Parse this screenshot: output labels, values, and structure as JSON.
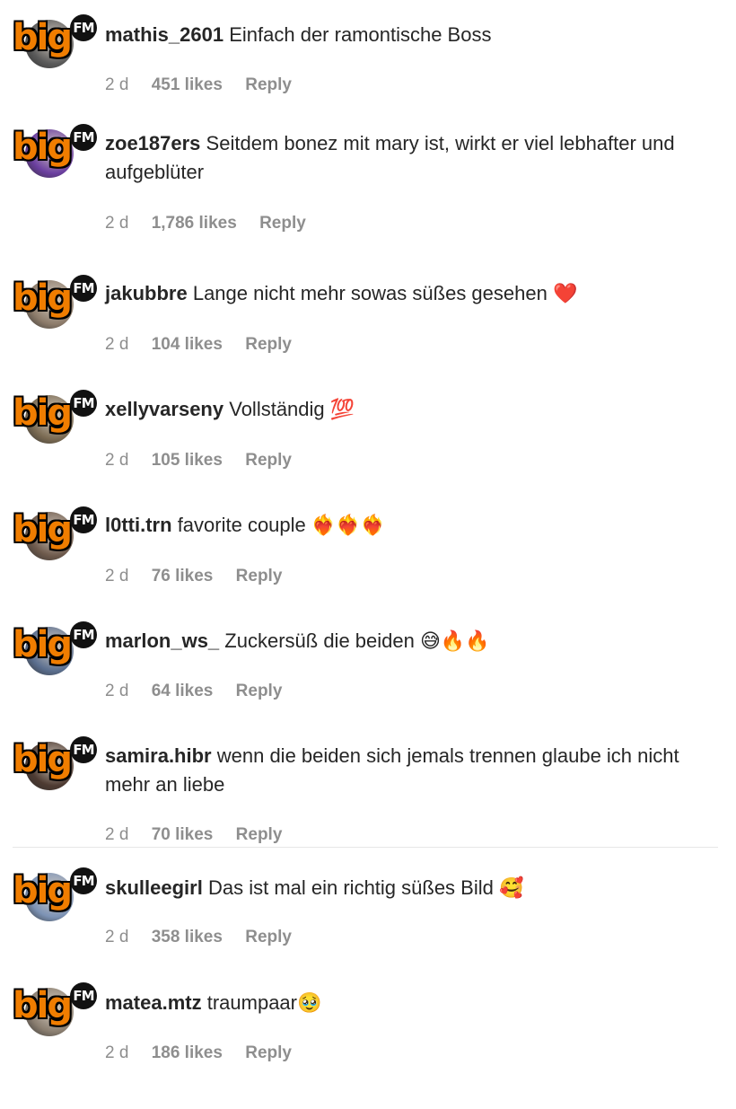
{
  "comments": [
    {
      "username": "mathis_2601",
      "text": "Einfach der ramontische Boss",
      "time": "2 d",
      "likes": "451 likes",
      "reply": "Reply",
      "avatar_bg": "#5a5a5a"
    },
    {
      "username": "zoe187ers",
      "text": "Seitdem bonez mit mary ist, wirkt er viel lebhafter und aufgeblüter",
      "time": "2 d",
      "likes": "1,786 likes",
      "reply": "Reply",
      "avatar_bg": "#6b3fa0"
    },
    {
      "username": "jakubbre",
      "text": "Lange nicht mehr sowas süßes gesehen ❤️",
      "time": "2 d",
      "likes": "104 likes",
      "reply": "Reply",
      "avatar_bg": "#8c7b6a"
    },
    {
      "username": "xellyvarseny",
      "text": "Vollständig 💯",
      "time": "2 d",
      "likes": "105 likes",
      "reply": "Reply",
      "avatar_bg": "#7a6a52"
    },
    {
      "username": "l0tti.trn",
      "text": "favorite couple ❤️‍🔥❤️‍🔥❤️‍🔥",
      "time": "2 d",
      "likes": "76 likes",
      "reply": "Reply",
      "avatar_bg": "#6e5a4c"
    },
    {
      "username": "marlon_ws_",
      "text": "Zuckersüß die beiden 😅🔥🔥",
      "time": "2 d",
      "likes": "64 likes",
      "reply": "Reply",
      "avatar_bg": "#5b6f8f"
    },
    {
      "username": "samira.hibr",
      "text": "wenn die beiden sich jemals trennen glaube ich nicht mehr an liebe",
      "time": "2 d",
      "likes": "70 likes",
      "reply": "Reply",
      "avatar_bg": "#4e3b32"
    },
    {
      "username": "skulleegirl",
      "text": "Das ist mal ein richtig süßes Bild 🥰",
      "time": "2 d",
      "likes": "358 likes",
      "reply": "Reply",
      "avatar_bg": "#7d93b5"
    },
    {
      "username": "matea.mtz",
      "text": "traumpaar🥹",
      "time": "2 d",
      "likes": "186 likes",
      "reply": "Reply",
      "avatar_bg": "#8a7e70"
    }
  ],
  "logo": {
    "big": "big",
    "fm": "FM"
  },
  "colors": {
    "logo_orange": "#f07d00",
    "meta_gray": "#8e8e8e",
    "text": "#262626"
  }
}
